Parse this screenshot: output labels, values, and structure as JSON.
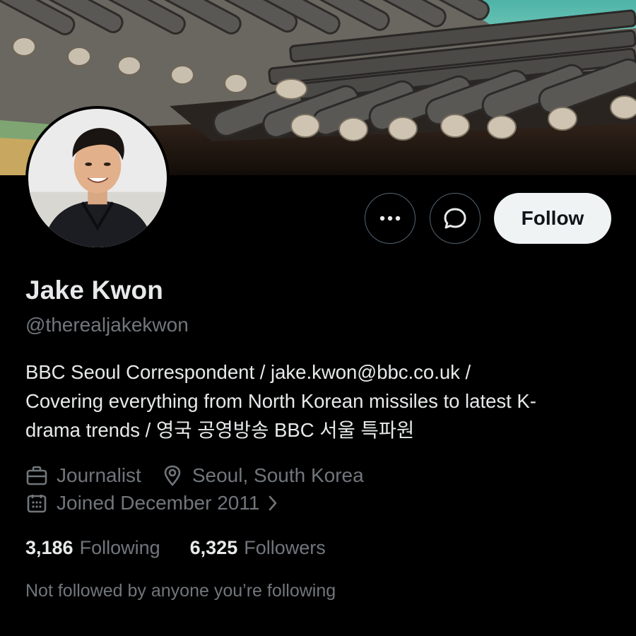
{
  "profile": {
    "display_name": "Jake Kwon",
    "handle": "@therealjakekwon",
    "bio_lines": [
      "BBC Seoul Correspondent / jake.kwon@bbc.co.uk /",
      "Covering everything from North Korean missiles to latest K-",
      "drama trends / 영국 공영방송 BBC 서울 특파원"
    ],
    "profession": "Journalist",
    "location": "Seoul, South Korea",
    "joined": "Joined December 2011"
  },
  "actions": {
    "follow_label": "Follow",
    "more_icon": "more-horizontal-icon",
    "message_icon": "message-bubble-icon"
  },
  "stats": {
    "following_count": "3,186",
    "following_label": "Following",
    "followers_count": "6,325",
    "followers_label": "Followers"
  },
  "followers_note": "Not followed by anyone you’re following",
  "icons": {
    "profession": "briefcase-icon",
    "location": "map-pin-icon",
    "joined": "calendar-icon",
    "chevron": "chevron-right-icon"
  },
  "colors": {
    "background": "#000000",
    "primary_text": "#e7e9ea",
    "secondary_text": "#71767b",
    "follow_bg": "#eff3f4",
    "follow_text": "#0f1419",
    "button_border": "#536471"
  }
}
